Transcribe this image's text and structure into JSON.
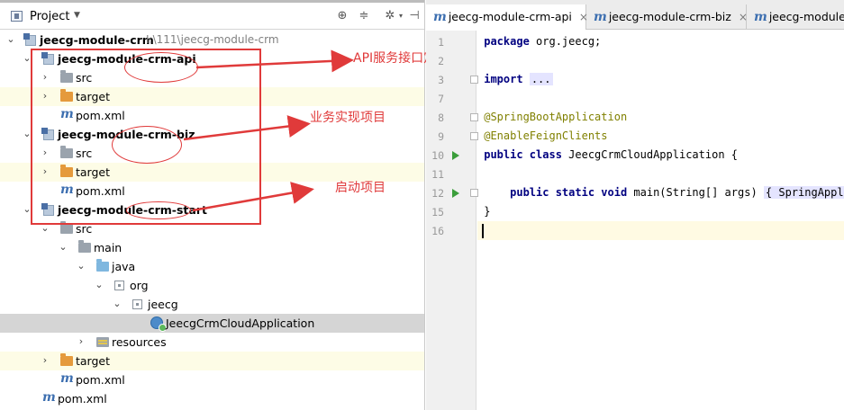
{
  "project_panel": {
    "title": "Project",
    "tree": [
      {
        "label": "jeecg-module-crm",
        "path": "I:\\111\\jeecg-module-crm",
        "bold": true
      },
      {
        "label": "jeecg-module-crm-api",
        "bold": true
      },
      {
        "label": "src"
      },
      {
        "label": "target"
      },
      {
        "label": "pom.xml"
      },
      {
        "label": "jeecg-module-crm-biz",
        "bold": true
      },
      {
        "label": "src"
      },
      {
        "label": "target"
      },
      {
        "label": "pom.xml"
      },
      {
        "label": "jeecg-module-crm-start",
        "bold": true
      },
      {
        "label": "src"
      },
      {
        "label": "main"
      },
      {
        "label": "java"
      },
      {
        "label": "org"
      },
      {
        "label": "jeecg"
      },
      {
        "label": "JeecgCrmCloudApplication"
      },
      {
        "label": "resources"
      },
      {
        "label": "target"
      },
      {
        "label": "pom.xml"
      },
      {
        "label": "pom.xml"
      }
    ]
  },
  "annotations": {
    "api": "API服务接口定义项目",
    "biz": "业务实现项目",
    "start": "启动项目",
    "color": "#e03a3a"
  },
  "editor": {
    "tabs": [
      {
        "label": "jeecg-module-crm-api"
      },
      {
        "label": "jeecg-module-crm-biz"
      },
      {
        "label": "jeecg-module-"
      }
    ],
    "lines": [
      {
        "num": "1",
        "code": "package org.jeecg;"
      },
      {
        "num": "2",
        "code": ""
      },
      {
        "num": "3",
        "code": "import ..."
      },
      {
        "num": "7",
        "code": ""
      },
      {
        "num": "8",
        "code": "@SpringBootApplication"
      },
      {
        "num": "9",
        "code": "@EnableFeignClients"
      },
      {
        "num": "10",
        "code": "public class JeecgCrmCloudApplication {"
      },
      {
        "num": "11",
        "code": ""
      },
      {
        "num": "12",
        "code": "    public static void main(String[] args) { SpringApplica"
      },
      {
        "num": "15",
        "code": "}"
      },
      {
        "num": "16",
        "code": ""
      }
    ]
  }
}
